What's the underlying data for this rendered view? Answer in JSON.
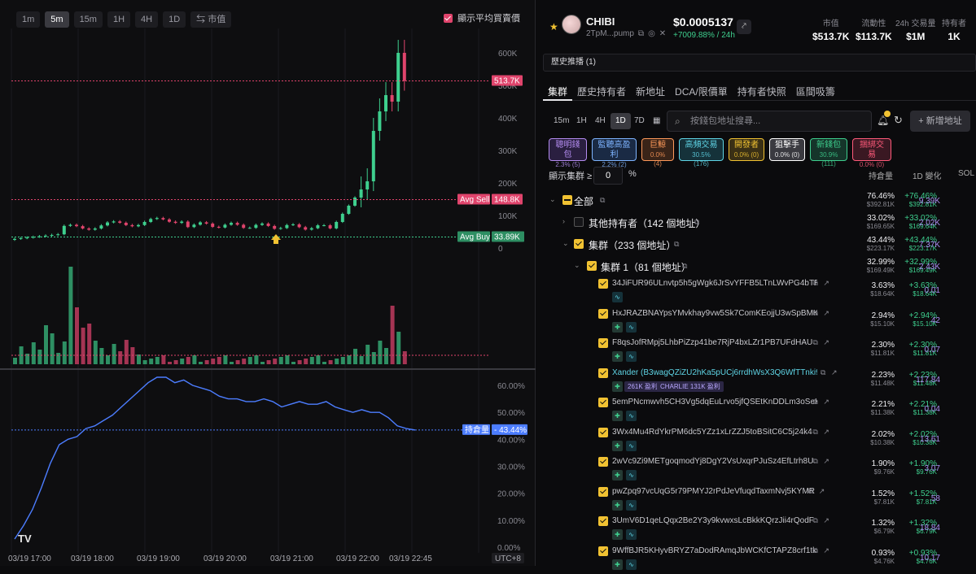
{
  "chart": {
    "timeframes": [
      "1m",
      "5m",
      "15m",
      "1H",
      "4H",
      "1D"
    ],
    "active_timeframe": "5m",
    "mcap_toggle": "⇆ 市值",
    "avg_toggle_label": "顯示平均買賣價",
    "price_axis": [
      "600K",
      "500K",
      "400K",
      "300K",
      "200K",
      "100K",
      "0"
    ],
    "current_label": "513.7K",
    "avg_sell_label": "Avg Sell",
    "avg_sell_value": "148.8K",
    "avg_buy_label": "Avg Buy",
    "avg_buy_value": "33.89K",
    "hold_axis": [
      "60.00%",
      "50.00%",
      "40.00%",
      "30.00%",
      "20.00%",
      "10.00%",
      "0.00%"
    ],
    "hold_label": "持倉量",
    "hold_value": "43.44%",
    "time_axis": [
      "03/19 17:00",
      "03/19 18:00",
      "03/19 19:00",
      "03/19 20:00",
      "03/19 21:00",
      "03/19 22:00",
      "03/19 22:45"
    ],
    "utc": "UTC+8",
    "logo": "TV"
  },
  "chart_data": {
    "type": "line",
    "note_series": "price in market cap (K)",
    "y_price_lim": [
      0,
      650
    ],
    "y_hold_lim": [
      0,
      65
    ],
    "avg_sell": 148.8,
    "avg_buy": 33.89,
    "current": 513.7,
    "hold_pct": [
      3,
      8,
      14,
      22,
      31,
      38,
      40,
      41,
      44,
      45,
      47,
      49,
      52,
      55,
      58,
      61,
      63,
      63,
      61,
      62,
      60,
      59,
      58,
      56,
      55,
      55,
      54,
      54,
      55,
      54,
      52,
      53,
      54,
      53,
      53,
      54,
      52,
      51,
      50,
      51,
      50,
      50,
      48,
      45,
      44,
      43.44
    ]
  },
  "header": {
    "token_name": "CHIBI",
    "token_addr": "2TpM...pump",
    "price": "$0.0005137",
    "change": "+7009.88% / 24h",
    "stats": [
      {
        "label": "市值",
        "value": "$513.7K"
      },
      {
        "label": "流動性",
        "value": "$113.7K"
      },
      {
        "label": "24h 交易量",
        "value": "$1M"
      },
      {
        "label": "持有者",
        "value": "1K"
      }
    ]
  },
  "broadcast": "歷史推播 (1)",
  "tabs": [
    "集群",
    "歷史持有者",
    "新地址",
    "DCA/限價單",
    "持有者快照",
    "區間吸籌"
  ],
  "controls": {
    "timeframes": [
      "15m",
      "1H",
      "4H",
      "1D",
      "7D"
    ],
    "active": "1D",
    "search_placeholder": "按錢包地址搜尋...",
    "add_label": "+ 新增地址"
  },
  "chips": [
    {
      "label": "聰明錢包",
      "sub": "2.3% (5)",
      "color": "#b48cf0",
      "bg": "#2a1f40"
    },
    {
      "label": "監聽高盈利",
      "sub": "2.2% (2)",
      "color": "#7eb4ff",
      "bg": "#1a2a44"
    },
    {
      "label": "巨鯨",
      "sub": "0.0% (4)",
      "color": "#ff9a5a",
      "bg": "#3a2418"
    },
    {
      "label": "高頻交易",
      "sub": "30.5% (176)",
      "color": "#5fd5e6",
      "bg": "#15323a"
    },
    {
      "label": "開發者",
      "sub": "0.0% (0)",
      "color": "#f1c232",
      "bg": "#3a3015"
    },
    {
      "label": "狙擊手",
      "sub": "0.0% (0)",
      "color": "#ffffff",
      "bg": "#3a3a40"
    },
    {
      "label": "新錢包",
      "sub": "30.9% (111)",
      "color": "#3ecf8e",
      "bg": "#15352a"
    },
    {
      "label": "捆綁交易",
      "sub": "0.0% (0)",
      "color": "#ff5a7a",
      "bg": "#3a1822"
    }
  ],
  "filter": {
    "label": "顯示集群 ≥",
    "value": "0",
    "unit": "%",
    "col_hold": "持倉量",
    "col_change": "1D 變化",
    "col_sol": "SOL"
  },
  "groups": [
    {
      "label": "全部",
      "pct": "76.46%",
      "usd": "$392.81K",
      "chg": "+76.46%",
      "chg_usd": "$392.81K",
      "sol": "9.39K"
    },
    {
      "label": "其他持有者（142 個地址）",
      "pct": "33.02%",
      "usd": "$169.65K",
      "chg": "+33.02%",
      "chg_usd": "$169.64K",
      "sol": "2.02K"
    },
    {
      "label": "集群（233 個地址）",
      "pct": "43.44%",
      "usd": "$223.17K",
      "chg": "+43.44%",
      "chg_usd": "$223.17K",
      "sol": "7.37K"
    },
    {
      "label": "集群 1（81 個地址）",
      "pct": "32.99%",
      "usd": "$169.49K",
      "chg": "+32.99%",
      "chg_usd": "$169.49K",
      "sol": "2.43K"
    }
  ],
  "wallets": [
    {
      "addr": "34JiFUR96ULnvtp5h5gWgk6JrSvYFFB5LTnLWvPG4bTR",
      "pct": "3.63%",
      "usd": "$18.64K",
      "chg": "+3.63%",
      "chg_usd": "$18.64K",
      "sol": "0.01"
    },
    {
      "addr": "HxJRAZBNAYpsYMvkhay9vw5Sk7ComKEojjU3wSpBMKuF",
      "pct": "2.94%",
      "usd": "$15.10K",
      "chg": "+2.94%",
      "chg_usd": "$15.10K",
      "sol": "42"
    },
    {
      "addr": "F8qsJofRMpj5LhbPiZzp41be7RjP4bxLZr1PB7UFdHAU",
      "pct": "2.30%",
      "usd": "$11.81K",
      "chg": "+2.30%",
      "chg_usd": "$11.81K",
      "sol": "0.07"
    },
    {
      "addr": "Xander (B3wagQZiZU2hKa5pUCj6rrdhWsX3Q6WfTTnki9P...",
      "pct": "2.23%",
      "usd": "$11.48K",
      "chg": "+2.23%",
      "chg_usd": "$11.48K",
      "sol": "117.84",
      "b1": "261K 盈利",
      "b2": "CHARLIE 131K 盈利"
    },
    {
      "addr": "5emPNcmwvh5CH3Vg5dqEuLrvo5jfQSEtKnDDLm3oSeK3",
      "pct": "2.21%",
      "usd": "$11.38K",
      "chg": "+2.21%",
      "chg_usd": "$11.38K",
      "sol": "0.04"
    },
    {
      "addr": "3Wx4Mu4RdYkrPM6dc5YZz1xLrZZJ5toBSitC6C5j24k4",
      "pct": "2.02%",
      "usd": "$10.38K",
      "chg": "+2.02%",
      "chg_usd": "$10.38K",
      "sol": "13.61"
    },
    {
      "addr": "2wVc9Zi9METgoqmodYj8DgY2VsUxqrPJuSz4EfLtrh8U",
      "pct": "1.90%",
      "usd": "$9.76K",
      "chg": "+1.90%",
      "chg_usd": "$9.76K",
      "sol": "3.07"
    },
    {
      "addr": "pwZpq97vcUqG5r79PMYJ2rPdJeVfuqdTaxmNvj5KYMR",
      "pct": "1.52%",
      "usd": "$7.81K",
      "chg": "+1.52%",
      "chg_usd": "$7.81K",
      "sol": "58"
    },
    {
      "addr": "3UmV6D1qeLQqx2Be2Y3y9kvwxsLcBkkKQrzJii4rQodF",
      "pct": "1.32%",
      "usd": "$6.79K",
      "chg": "+1.32%",
      "chg_usd": "$6.79K",
      "sol": "18.84"
    },
    {
      "addr": "9WffBJR5KHyvBRYZ7aDodRAmqJbWCKfCTAPZ8crf1tk5",
      "pct": "0.93%",
      "usd": "$4.76K",
      "chg": "+0.93%",
      "chg_usd": "$4.76K",
      "sol": "10.17"
    }
  ],
  "colors": {
    "up": "#3ecf8e",
    "down": "#e0446c",
    "hold": "#4c7dff",
    "accent": "#f1c232"
  }
}
